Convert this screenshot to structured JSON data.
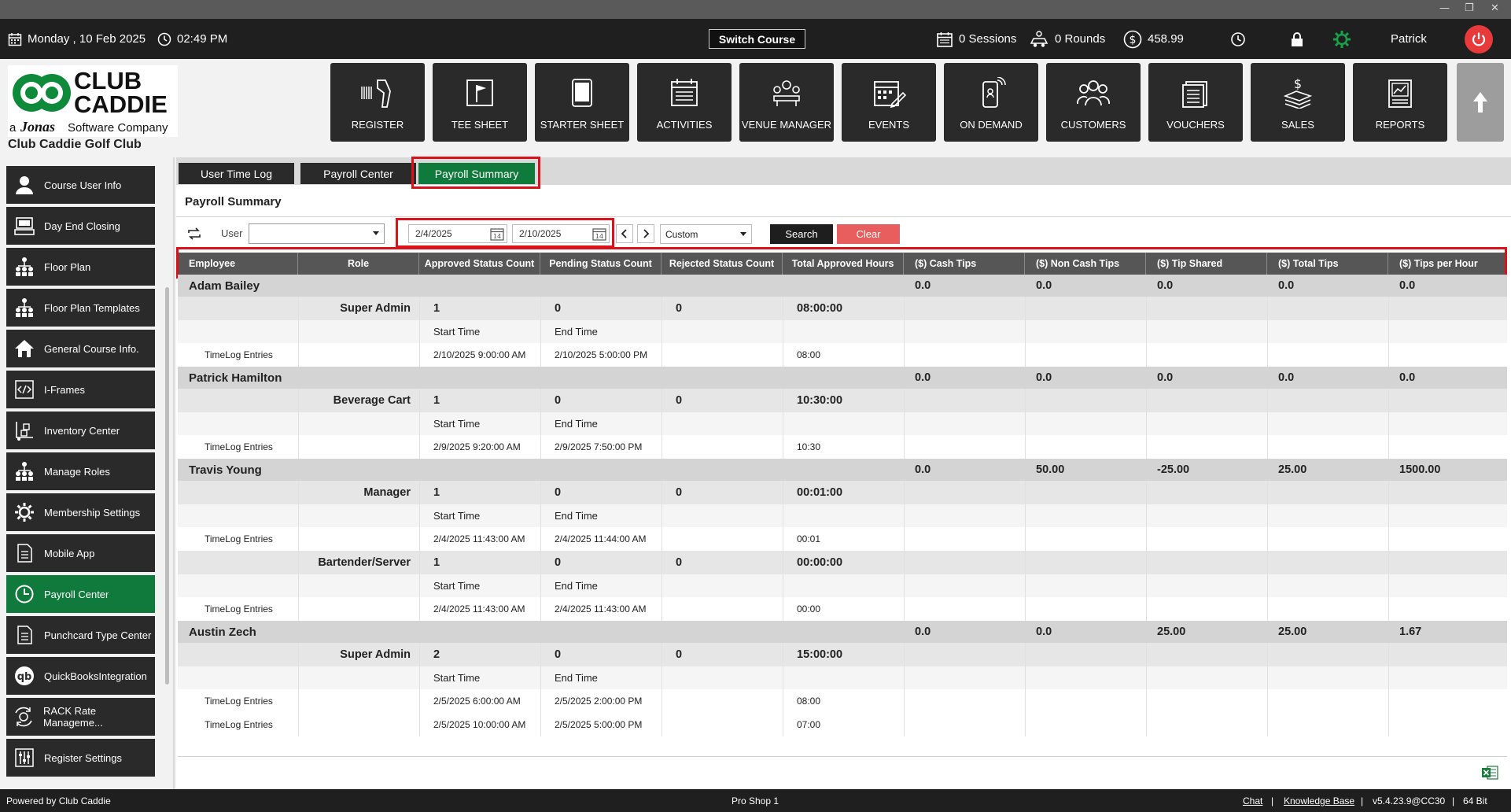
{
  "window": {
    "min_glyph": "—",
    "max_glyph": "❐",
    "close_glyph": "✕"
  },
  "topbar": {
    "date": "Monday ,  10 Feb 2025",
    "time": "02:49 PM",
    "switch_course": "Switch Course",
    "sessions": "0 Sessions",
    "rounds": "0 Rounds",
    "balance": "458.99",
    "user": "Patrick"
  },
  "logo": {
    "line1": "CLUB",
    "line2": "CADDIE",
    "tag_a": "a",
    "tag_brand": "Jonas",
    "tag_rest": "Software Company"
  },
  "club_name": "Club Caddie Golf Club",
  "nav": [
    {
      "label": "REGISTER",
      "icon": "barcode-scanner-icon"
    },
    {
      "label": "TEE SHEET",
      "icon": "flag-icon"
    },
    {
      "label": "STARTER SHEET",
      "icon": "tablet-icon"
    },
    {
      "label": "ACTIVITIES",
      "icon": "calendar-list-icon"
    },
    {
      "label": "VENUE MANAGER",
      "icon": "venue-icon"
    },
    {
      "label": "EVENTS",
      "icon": "calendar-edit-icon"
    },
    {
      "label": "ON DEMAND",
      "icon": "mobile-signal-icon"
    },
    {
      "label": "CUSTOMERS",
      "icon": "customers-icon"
    },
    {
      "label": "VOUCHERS",
      "icon": "voucher-icon"
    },
    {
      "label": "SALES",
      "icon": "sales-icon"
    },
    {
      "label": "REPORTS",
      "icon": "reports-icon"
    }
  ],
  "sidebar": [
    {
      "label": "Course User Info",
      "icon": "user-icon"
    },
    {
      "label": "Day End Closing",
      "icon": "register-icon"
    },
    {
      "label": "Floor Plan",
      "icon": "hierarchy-icon"
    },
    {
      "label": "Floor Plan Templates",
      "icon": "hierarchy-icon"
    },
    {
      "label": "General Course Info.",
      "icon": "home-icon"
    },
    {
      "label": "I-Frames",
      "icon": "code-icon"
    },
    {
      "label": "Inventory Center",
      "icon": "inventory-icon"
    },
    {
      "label": "Manage Roles",
      "icon": "hierarchy-icon"
    },
    {
      "label": "Membership Settings",
      "icon": "gear-icon"
    },
    {
      "label": "Mobile App",
      "icon": "document-icon"
    },
    {
      "label": "Payroll Center",
      "icon": "clock-icon",
      "active": true
    },
    {
      "label": "Punchcard Type Center",
      "icon": "document-icon"
    },
    {
      "label": "QuickBooksIntegration",
      "icon": "quickbooks-icon"
    },
    {
      "label": "RACK Rate Manageme...",
      "icon": "rate-icon"
    },
    {
      "label": "Register Settings",
      "icon": "settings-panel-icon"
    }
  ],
  "tabs": [
    {
      "label": "User Time Log"
    },
    {
      "label": "Payroll Center"
    },
    {
      "label": "Payroll Summary",
      "active": true
    }
  ],
  "page_title": "Payroll Summary",
  "filters": {
    "user_label": "User",
    "user_value": "",
    "start_date": "2/4/2025",
    "end_date": "2/10/2025",
    "range": "Custom",
    "search": "Search",
    "clear": "Clear"
  },
  "columns": [
    "Employee",
    "Role",
    "Approved Status Count",
    "Pending Status Count",
    "Rejected Status Count",
    "Total Approved Hours",
    "($) Cash Tips",
    "($) Non Cash Tips",
    "($) Tip Shared",
    "($) Total Tips",
    "($) Tips per Hour"
  ],
  "rows": [
    {
      "type": "emp",
      "name": "Adam Bailey",
      "cash": "0.0",
      "noncash": "0.0",
      "shared": "0.0",
      "total": "0.0",
      "perhour": "0.0"
    },
    {
      "type": "role",
      "role": "Super Admin",
      "approved": "1",
      "pending": "0",
      "rejected": "0",
      "hours": "08:00:00"
    },
    {
      "type": "sub",
      "start": "Start Time",
      "end": "End Time"
    },
    {
      "type": "tl",
      "label": "TimeLog Entries",
      "start": "2/10/2025 9:00:00 AM",
      "end": "2/10/2025 5:00:00 PM",
      "hours": "08:00"
    },
    {
      "type": "emp",
      "name": "Patrick Hamilton",
      "cash": "0.0",
      "noncash": "0.0",
      "shared": "0.0",
      "total": "0.0",
      "perhour": "0.0"
    },
    {
      "type": "role",
      "role": "Beverage Cart",
      "approved": "1",
      "pending": "0",
      "rejected": "0",
      "hours": "10:30:00"
    },
    {
      "type": "sub",
      "start": "Start Time",
      "end": "End Time"
    },
    {
      "type": "tl",
      "label": "TimeLog Entries",
      "start": "2/9/2025 9:20:00 AM",
      "end": "2/9/2025 7:50:00 PM",
      "hours": "10:30"
    },
    {
      "type": "emp",
      "name": "Travis Young",
      "cash": "0.0",
      "noncash": "50.00",
      "shared": "-25.00",
      "total": "25.00",
      "perhour": "1500.00"
    },
    {
      "type": "role",
      "role": "Manager",
      "approved": "1",
      "pending": "0",
      "rejected": "0",
      "hours": "00:01:00"
    },
    {
      "type": "sub",
      "start": "Start Time",
      "end": "End Time"
    },
    {
      "type": "tl",
      "label": "TimeLog Entries",
      "start": "2/4/2025 11:43:00 AM",
      "end": "2/4/2025 11:44:00 AM",
      "hours": "00:01"
    },
    {
      "type": "role",
      "role": "Bartender/Server",
      "approved": "1",
      "pending": "0",
      "rejected": "0",
      "hours": "00:00:00"
    },
    {
      "type": "sub",
      "start": "Start Time",
      "end": "End Time"
    },
    {
      "type": "tl",
      "label": "TimeLog Entries",
      "start": "2/4/2025 11:43:00 AM",
      "end": "2/4/2025 11:43:00 AM",
      "hours": "00:00"
    },
    {
      "type": "emp",
      "name": "Austin Zech",
      "cash": "0.0",
      "noncash": "0.0",
      "shared": "25.00",
      "total": "25.00",
      "perhour": "1.67"
    },
    {
      "type": "role",
      "role": "Super Admin",
      "approved": "2",
      "pending": "0",
      "rejected": "0",
      "hours": "15:00:00"
    },
    {
      "type": "sub",
      "start": "Start Time",
      "end": "End Time"
    },
    {
      "type": "tl",
      "label": "TimeLog Entries",
      "start": "2/5/2025 6:00:00 AM",
      "end": "2/5/2025 2:00:00 PM",
      "hours": "08:00"
    },
    {
      "type": "tl",
      "label": "TimeLog Entries",
      "start": "2/5/2025 10:00:00 AM",
      "end": "2/5/2025 5:00:00 PM",
      "hours": "07:00"
    }
  ],
  "footer": {
    "powered": "Powered by Club Caddie",
    "terminal": "Pro Shop 1",
    "chat": "Chat",
    "kb": "Knowledge Base",
    "version": "v5.4.23.9@CC30",
    "bits": "64 Bit",
    "sep": "|"
  },
  "colors": {
    "accent_green": "#0f7a3c",
    "highlight_red": "#d9121c",
    "clear_red": "#e85d5d",
    "dark": "#2a2a2a"
  }
}
